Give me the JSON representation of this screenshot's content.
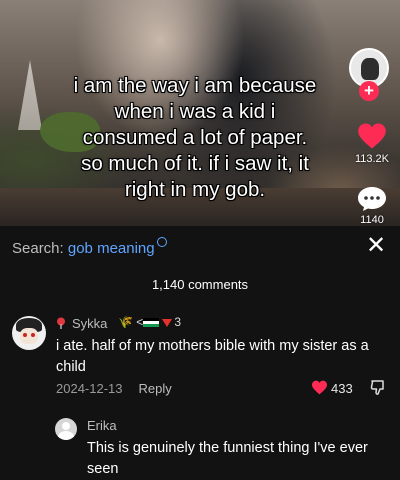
{
  "video": {
    "caption_lines": [
      "i am the way i am because",
      "when i was a kid i",
      "consumed a lot of paper.",
      "so much of it. if i saw it, it",
      "right in my gob."
    ],
    "like_count": "113.2K",
    "comment_count": "1140"
  },
  "comments_panel": {
    "search_prefix": "Search: ",
    "search_query": "gob meaning",
    "comment_count_label": "1,140 comments",
    "close_symbol": "✕"
  },
  "comment": {
    "username": "Sykka",
    "flair_arrow": "<",
    "flair_number": "3",
    "text": "i ate. half of my mothers bible with my sister as a child",
    "date": "2024-12-13",
    "reply_label": "Reply",
    "like_count": "433"
  },
  "reply": {
    "username": "Erika",
    "text": "This is genuinely the funniest thing I've ever seen"
  },
  "colors": {
    "accent_red": "#fe2c55",
    "link_blue": "#5fa4ff",
    "sheet_bg": "#121212"
  }
}
